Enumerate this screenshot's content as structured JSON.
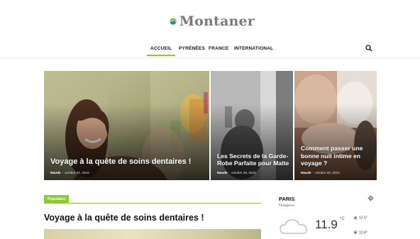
{
  "header": {
    "brand": "Montaner",
    "brand_colors": {
      "sun": "#8dc63f",
      "sky": "#2a7fc4",
      "text": "#7a7a7a"
    }
  },
  "nav": {
    "items": [
      {
        "label": "ACCUEIL",
        "active": true
      },
      {
        "label": "PYRÉNÉES",
        "active": false
      },
      {
        "label": "FRANCE",
        "active": false
      },
      {
        "label": "INTERNATIONAL",
        "active": false
      }
    ],
    "search_icon": "search-icon"
  },
  "featured": [
    {
      "title": "Voyage à la quête de soins dentaires !",
      "author": "Maude",
      "dash": "-",
      "date": "octobre 26, 2023"
    },
    {
      "title": "Les Secrets de la Garde-Robe Parfaite pour Malte",
      "author": "Maude",
      "dash": "-",
      "date": "octobre 26, 2023"
    },
    {
      "title": "Comment passer une bonne nuit intime en voyage ?",
      "author": "Maude",
      "dash": "-",
      "date": "octobre 20, 2023"
    }
  ],
  "popular": {
    "label": "Populaire",
    "article_title": "Voyage à la quête de soins dentaires !"
  },
  "weather": {
    "city": "PARIS",
    "condition": "Nuageux",
    "temperature": "11.9",
    "unit": "°C",
    "high": "12.5°",
    "low": "10.8°",
    "icon": "cloud-icon"
  },
  "accent": "#8dc63f"
}
